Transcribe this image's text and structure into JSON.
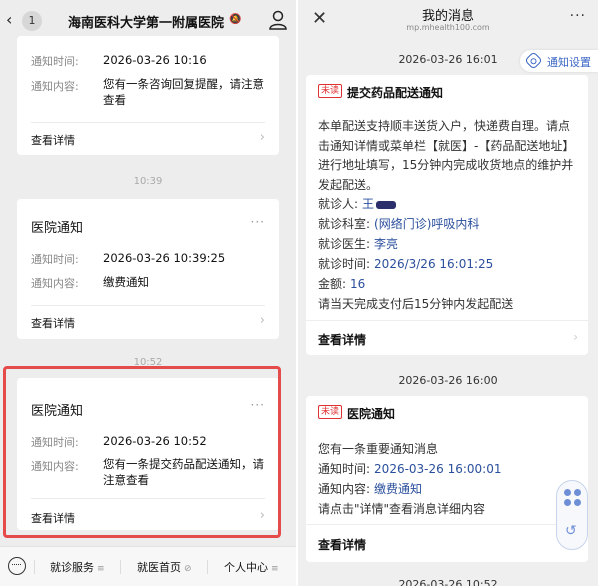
{
  "left": {
    "header": {
      "badge": "1",
      "title": "海南医科大学第一附属医院"
    },
    "card1": {
      "time_label": "通知时间:",
      "time_value": "2026-03-26 10:16",
      "content_label": "通知内容:",
      "content_value": "您有一条咨询回复提醒，请注意查看",
      "more": "查看详情"
    },
    "sep1": "10:39",
    "card2": {
      "title": "医院通知",
      "time_label": "通知时间:",
      "time_value": "2026-03-26 10:39:25",
      "content_label": "通知内容:",
      "content_value": "缴费通知",
      "more": "查看详情"
    },
    "sep2": "10:52",
    "card3": {
      "title": "医院通知",
      "time_label": "通知时间:",
      "time_value": "2026-03-26 10:52",
      "content_label": "通知内容:",
      "content_value": "您有一条提交药品配送通知，请注意查看",
      "more": "查看详情"
    },
    "footer": {
      "items": [
        "就诊服务",
        "就医首页",
        "个人中心"
      ]
    },
    "highlight_color": "#e54b4b"
  },
  "right": {
    "header": {
      "title": "我的消息",
      "subtitle": "mp.mhealth100.com"
    },
    "notice_settings": "通知设置",
    "time1": "2026-03-26 16:01",
    "msg1": {
      "tag": "未读",
      "title": "提交药品配送通知",
      "body": "本单配送支持顺丰送货入户，快递费自理。请点击通知详情或菜单栏【就医】-【药品配送地址】进行地址填写，15分钟内完成收货地点的维护并发起配送。",
      "patient_label": "就诊人:",
      "patient_value": "王",
      "dept_label": "就诊科室:",
      "dept_value": "(网络门诊)呼吸内科",
      "doctor_label": "就诊医生:",
      "doctor_value": "李亮",
      "visit_label": "就诊时间:",
      "visit_value": "2026/3/26 16:01:25",
      "amount_label": "金额:",
      "amount_value": "16",
      "note": "请当天完成支付后15分钟内发起配送",
      "more": "查看详情"
    },
    "time2": "2026-03-26 16:00",
    "msg2": {
      "tag": "未读",
      "title": "医院通知",
      "line1": "您有一条重要通知消息",
      "time_label": "通知时间:",
      "time_value": "2026-03-26 16:00:01",
      "content_label": "通知内容:",
      "content_value": "缴费通知",
      "note": "请点击\"详情\"查看消息详细内容",
      "more": "查看详情"
    },
    "time3": "2026-03-26 10:52",
    "accent": "#2a4f9c",
    "unread_color": "#e03131"
  }
}
